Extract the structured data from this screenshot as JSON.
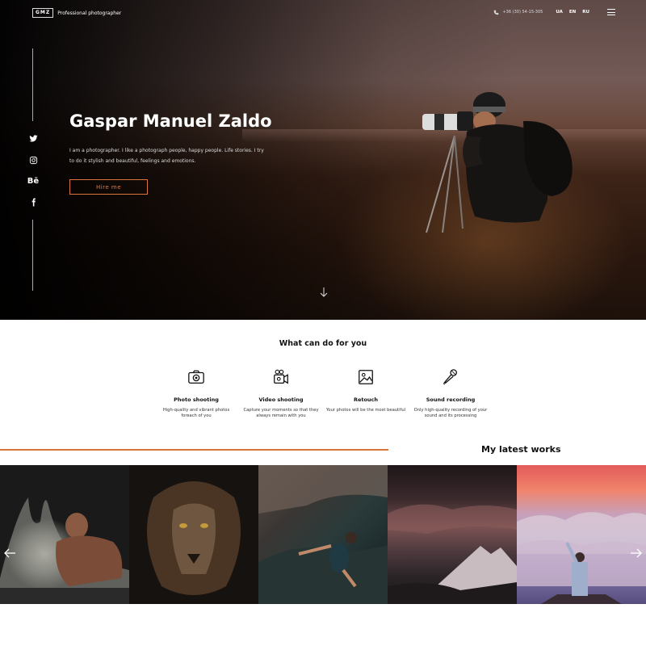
{
  "header": {
    "logo_mark": "GMZ",
    "logo_text": "Professional photographer",
    "phone": "+36 (30) 54-15-305",
    "languages": [
      "UA",
      "EN",
      "RU"
    ]
  },
  "hero": {
    "title": "Gaspar Manuel Zaldo",
    "description": "I am a photographer. I like a photograph people, happy people. Life stories. I try to do it stylish and beautiful, feelings and emotions.",
    "button_label": "Hire me"
  },
  "social": {
    "behance_label": "Bē"
  },
  "services": {
    "title": "What can do for you",
    "items": [
      {
        "name": "Photo shooting",
        "text": "High-quality and vibrant photos foreach of you",
        "icon": "camera-icon"
      },
      {
        "name": "Video shooting",
        "text": "Capture your moments so that they always remain with you",
        "icon": "video-camera-icon"
      },
      {
        "name": "Retouch",
        "text": "Your photos will be the most beautiful",
        "icon": "image-icon"
      },
      {
        "name": "Sound recording",
        "text": "Only high-quality recording of your sound and its processing",
        "icon": "microphone-icon"
      }
    ]
  },
  "works": {
    "title": "My latest works"
  },
  "colors": {
    "accent": "#d8753a"
  }
}
